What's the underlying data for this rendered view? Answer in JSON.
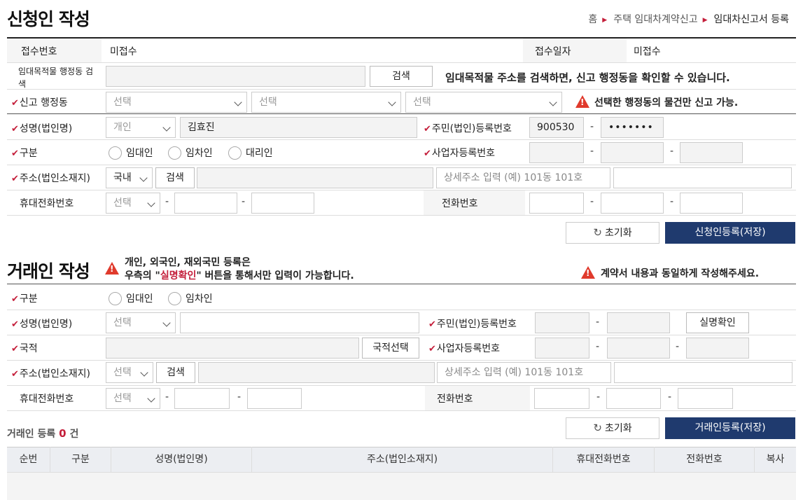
{
  "header": {
    "title": "신청인 작성",
    "breadcrumb": [
      "홈",
      "주택 임대차계약신고",
      "임대차신고서 등록"
    ]
  },
  "applicant": {
    "receipt_no_label": "접수번호",
    "receipt_no_value": "미접수",
    "receipt_date_label": "접수일자",
    "receipt_date_value": "미접수",
    "property_search_label": "임대목적물 행정동 검색",
    "search_button": "검색",
    "property_notice": "임대목적물 주소를 검색하면, 신고 행정동을 확인할 수 있습니다.",
    "report_dong_label": "신고 행정동",
    "select_placeholder": "선택",
    "dong_warning": "선택한 행정동의 물건만 신고 가능.",
    "name_label": "성명(법인명)",
    "person_type": "개인",
    "name_value": "김효진",
    "resident_no_label": "주민(법인)등록번호",
    "resident_no_front": "900530",
    "resident_no_back": "•••••••",
    "category_label": "구분",
    "radio_lessor": "임대인",
    "radio_lessee": "임차인",
    "radio_agent": "대리인",
    "business_no_label": "사업자등록번호",
    "address_label": "주소(법인소재지)",
    "address_region": "국내",
    "address_search": "검색",
    "detail_address_placeholder": "상세주소 입력 (예) 101동 101호",
    "mobile_label": "휴대전화번호",
    "phone_label": "전화번호",
    "reset_button": "초기화",
    "register_button": "신청인등록(저장)",
    "dash": "-"
  },
  "counterparty": {
    "title": "거래인 작성",
    "notice_line1": "개인, 외국인, 재외국민 등록은",
    "notice_line2_pre": "우측의 \"",
    "notice_highlight": "실명확인",
    "notice_line2_post": "\" 버튼을 통해서만 입력이 가능합니다.",
    "right_warning": "계약서 내용과 동일하게 작성해주세요.",
    "category_label": "구분",
    "radio_lessor": "임대인",
    "radio_lessee": "임차인",
    "name_label": "성명(법인명)",
    "resident_no_label": "주민(법인)등록번호",
    "verify_button": "실명확인",
    "nationality_label": "국적",
    "nationality_button": "국적선택",
    "business_no_label": "사업자등록번호",
    "address_label": "주소(법인소재지)",
    "address_search": "검색",
    "detail_address_placeholder": "상세주소 입력 (예) 101동 101호",
    "mobile_label": "휴대전화번호",
    "phone_label": "전화번호",
    "select_placeholder": "선택",
    "count_label_pre": "거래인 등록",
    "count_value": "0",
    "count_label_post": "건",
    "reset_button": "초기화",
    "register_button": "거래인등록(저장)",
    "table_headers": [
      "순번",
      "구분",
      "성명(법인명)",
      "주소(법인소재지)",
      "휴대전화번호",
      "전화번호",
      "복사"
    ]
  },
  "colors": {
    "navy": "#1f3a6e",
    "red": "#c41e3a",
    "warning": "#e03a2c"
  }
}
